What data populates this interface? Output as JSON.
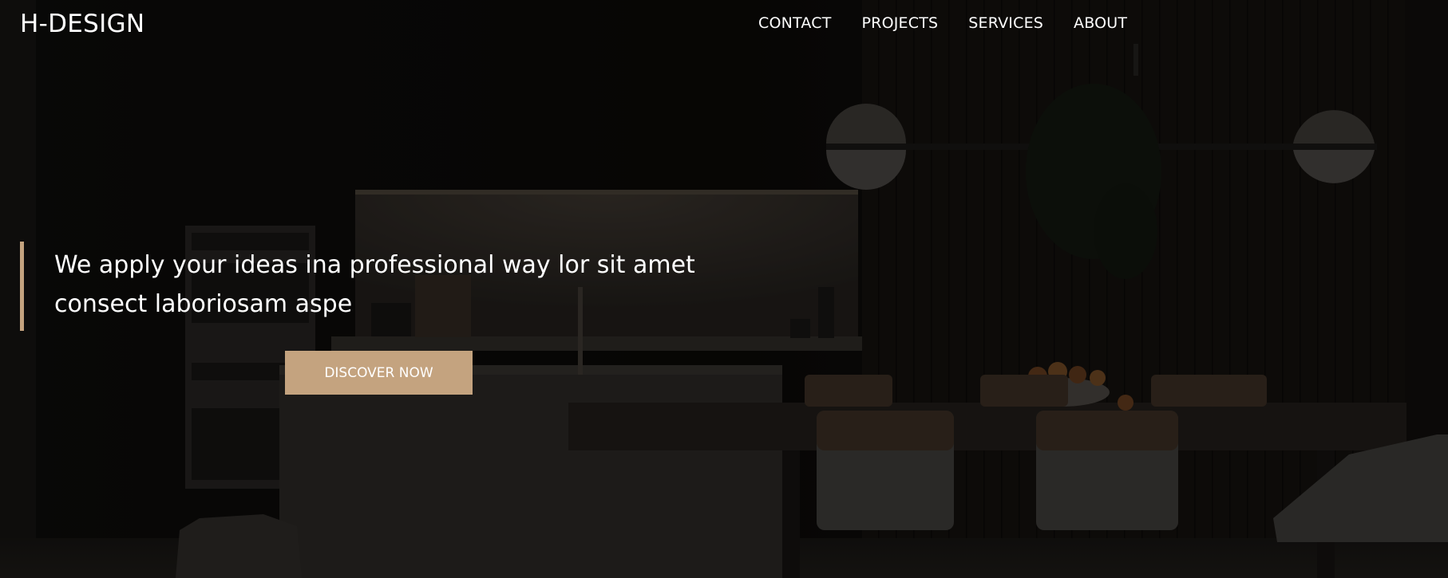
{
  "brand": {
    "logo_text": "H-DESIGN"
  },
  "nav": {
    "items": [
      {
        "label": "CONTACT"
      },
      {
        "label": "PROJECTS"
      },
      {
        "label": "SERVICES"
      },
      {
        "label": "ABOUT"
      }
    ]
  },
  "hero": {
    "headline": "We apply your ideas ina professional way lor sit amet consect laboriosam aspe",
    "cta_label": "DISCOVER NOW",
    "accent_color": "#c4a37f"
  }
}
